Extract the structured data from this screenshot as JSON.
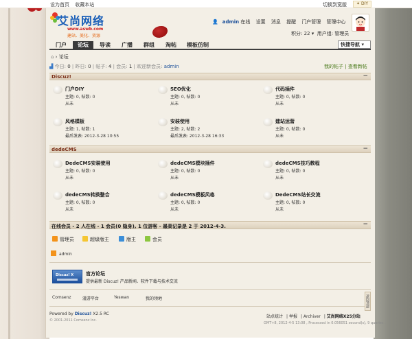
{
  "topbar": {
    "set_home": "设为首页",
    "bookmark": "收藏本站",
    "switch_style": "切换到宽版",
    "diy": "DIY"
  },
  "logo": {
    "title": "艾尚网络",
    "url": "www.aswb.com",
    "slogan": "建站、美化、资源"
  },
  "user": {
    "name": "admin",
    "status": "在线",
    "links": [
      "设置",
      "消息",
      "提醒",
      "门户管理",
      "管理中心",
      "退出"
    ],
    "points": "积分: 22",
    "group": "用户组: 管理员"
  },
  "nav": {
    "items": [
      "门户",
      "论坛",
      "导读",
      "广播",
      "群组",
      "淘帖",
      "模板仿制"
    ],
    "active_index": 1,
    "quick_nav": "快捷导航"
  },
  "breadcrumb": {
    "home_icon": "home-icon",
    "current": "论坛"
  },
  "stats": {
    "today_label": "今日:",
    "today": "0",
    "yesterday_label": "昨日:",
    "yesterday": "0",
    "posts_label": "帖子:",
    "posts": "4",
    "members_label": "会员:",
    "members": "1",
    "welcome_label": "欢迎新会员:",
    "welcome_user": "admin",
    "my_posts": "我的帖子",
    "new_posts": "查看新帖"
  },
  "sections": [
    {
      "title": "Discuz!",
      "forums": [
        {
          "name": "门户DIY",
          "counts": "主题: 0, 帖数: 0",
          "last": "从未"
        },
        {
          "name": "SEO优化",
          "counts": "主题: 0, 帖数: 0",
          "last": "从未"
        },
        {
          "name": "代码插件",
          "counts": "主题: 0, 帖数: 0",
          "last": "从未"
        },
        {
          "name": "风格模板",
          "counts": "主题: 1, 帖数: 1",
          "last": "最后发表: 2012-3-28 10:55"
        },
        {
          "name": "安装使用",
          "counts": "主题: 2, 帖数: 2",
          "last": "最后发表: 2012-3-28 16:33"
        },
        {
          "name": "建站运营",
          "counts": "主题: 0, 帖数: 0",
          "last": "从未"
        }
      ]
    },
    {
      "title": "dedeCMS",
      "forums": [
        {
          "name": "DedeCMS安装使用",
          "counts": "主题: 0, 帖数: 0",
          "last": "从未"
        },
        {
          "name": "dedeCMS模块插件",
          "counts": "主题: 0, 帖数: 0",
          "last": "从未"
        },
        {
          "name": "dedeCMS技巧教程",
          "counts": "主题: 0, 帖数: 0",
          "last": "从未"
        },
        {
          "name": "dedeCMS转换整合",
          "counts": "主题: 0, 帖数: 0",
          "last": "从未"
        },
        {
          "name": "dedeCMS模板风格",
          "counts": "主题: 0, 帖数: 0",
          "last": "从未"
        },
        {
          "name": "DedeCMS站长交流",
          "counts": "主题: 0, 帖数: 0",
          "last": "从未"
        }
      ]
    }
  ],
  "online": {
    "title": "在线会员 - 2 人在线 - 1 会员(0 隐身), 1 位游客 - 最高记录是 2 于 2012-4-3.",
    "legend": [
      {
        "label": "管理员",
        "color": "#f3931b"
      },
      {
        "label": "超级版主",
        "color": "#f5c633"
      },
      {
        "label": "版主",
        "color": "#3b8ed8"
      },
      {
        "label": "会员",
        "color": "#8cc63f"
      }
    ],
    "online_user": "admin"
  },
  "promo": {
    "badge": "Discuz! X",
    "title": "官方论坛",
    "desc": "提供最新 Discuz! 产品新闻、软件下载与技术交流"
  },
  "friend_links": [
    "Comsenz",
    "漫游平台",
    "Yeswan",
    "我的领地"
  ],
  "footer": {
    "powered_prefix": "Powered by ",
    "powered_name": "Discuz!",
    "version": " X2.5 RC",
    "copyright": "© 2001-2011 Comsenz Inc.",
    "links": [
      "站点统计",
      "举报",
      "Archiver"
    ],
    "site": "艾尚网络X25分站",
    "meta": "GMT+8, 2012-4-5 13:08 , Processed in 0.056051 second(s), 9 queries .",
    "back_top": "返回顶部"
  }
}
